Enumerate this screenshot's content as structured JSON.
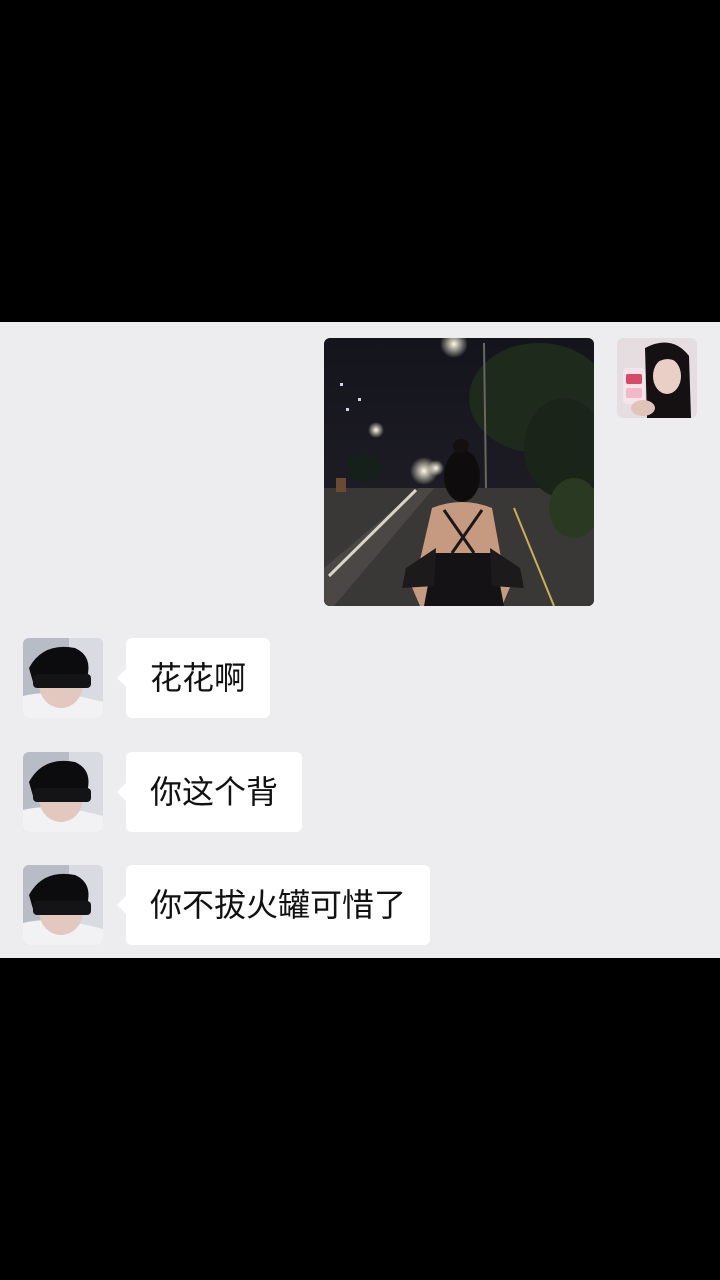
{
  "chat": {
    "messages": [
      {
        "sender": "self",
        "type": "image",
        "image": "night-street-photo"
      },
      {
        "sender": "other",
        "type": "text",
        "text": "花花啊"
      },
      {
        "sender": "other",
        "type": "text",
        "text": "你这个背"
      },
      {
        "sender": "other",
        "type": "text",
        "text": "你不拔火罐可惜了"
      }
    ]
  },
  "colors": {
    "chat_background": "#ededf0",
    "bubble_other": "#ffffff",
    "letterbox": "#000000"
  },
  "icons": {
    "self_avatar": "avatar-girl-selfie",
    "other_avatar": "avatar-boy-eyes-covered"
  }
}
